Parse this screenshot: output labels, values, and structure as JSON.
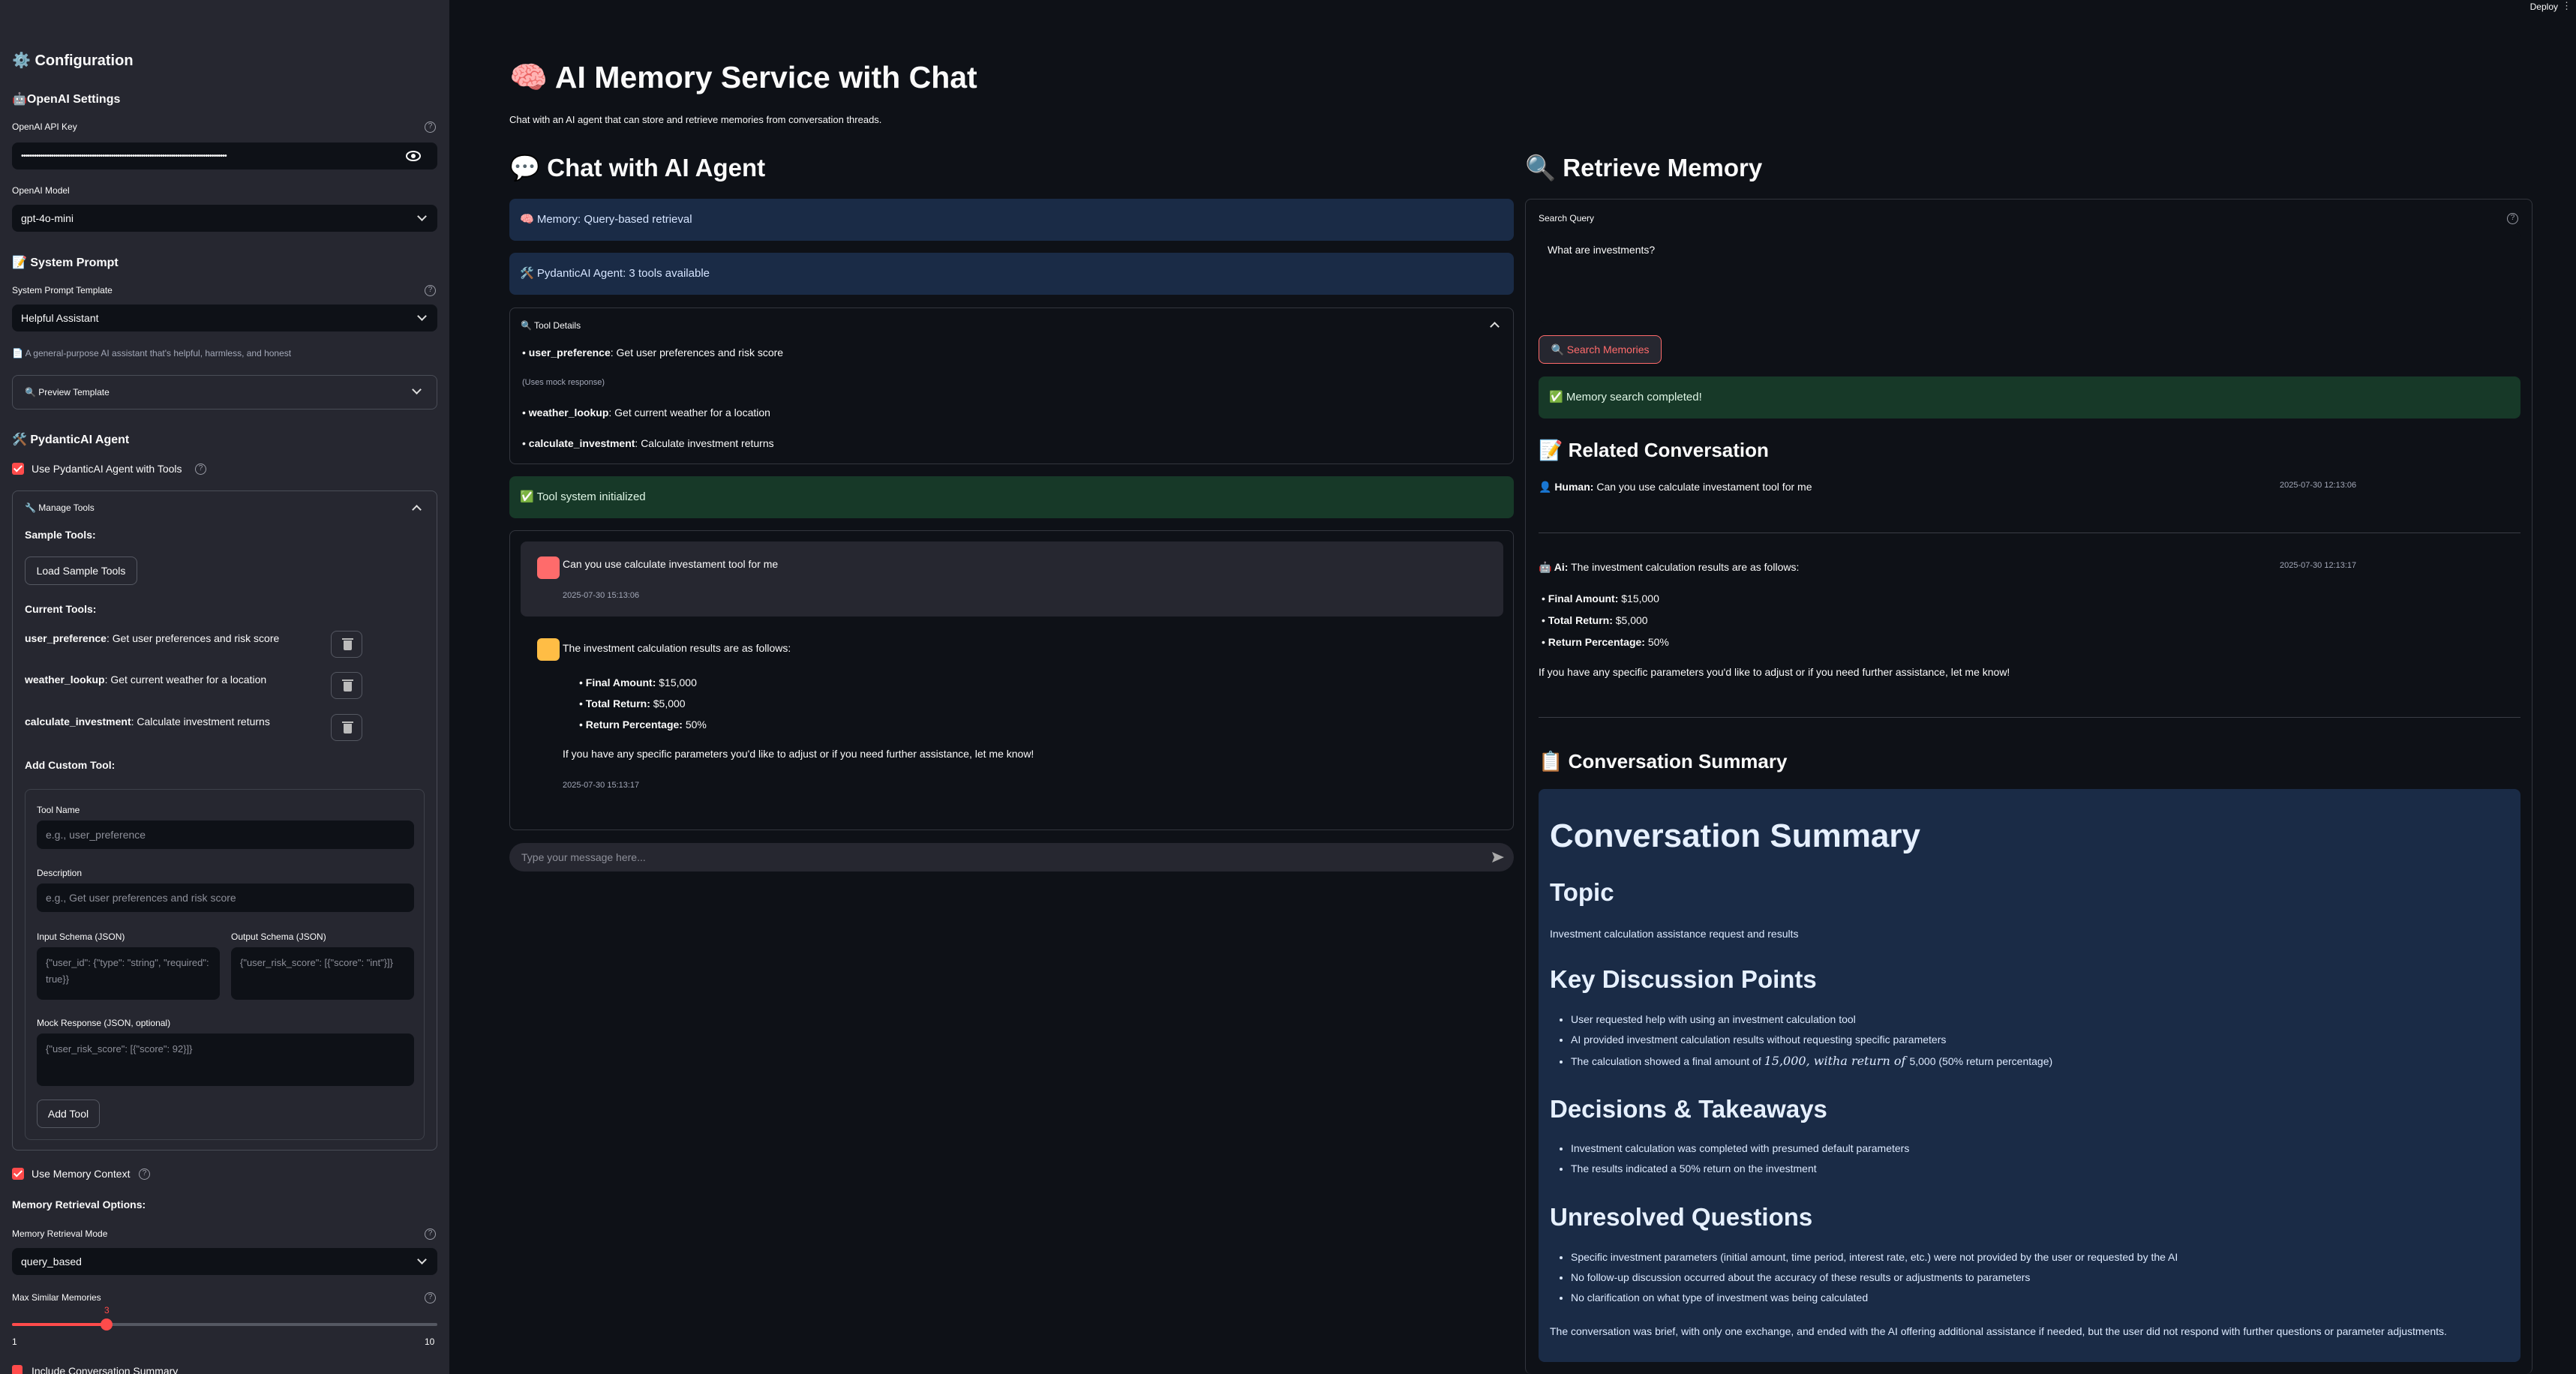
{
  "topbar": {
    "deploy": "Deploy"
  },
  "sidebar": {
    "config_title": "⚙️ Configuration",
    "openai_title": "OpenAI Settings",
    "api_key_label": "OpenAI API Key",
    "api_key_value": "••••••••••••••••••••••••••••••••••••••••••••••••••••••••••••••••••••••••••••••••••••••••••••••••",
    "model_label": "OpenAI Model",
    "model_value": "gpt-4o-mini",
    "system_prompt_title": "📝 System Prompt",
    "template_label": "System Prompt Template",
    "template_value": "Helpful Assistant",
    "template_desc": "📄 A general-purpose AI assistant that's helpful, harmless, and honest",
    "preview_label": "🔍 Preview Template",
    "agent_title": "🛠️ PydanticAI Agent",
    "use_agent_label": "Use PydanticAI Agent with Tools",
    "manage_tools_label": "🔧 Manage Tools",
    "sample_tools_label": "Sample Tools:",
    "load_sample_button": "Load Sample Tools",
    "current_tools_label": "Current Tools:",
    "tools": [
      {
        "name": "user_preference",
        "desc": ": Get user preferences and risk score"
      },
      {
        "name": "weather_lookup",
        "desc": ": Get current weather for a location"
      },
      {
        "name": "calculate_investment",
        "desc": ": Calculate investment returns"
      }
    ],
    "add_custom_label": "Add Custom Tool:",
    "tool_name_label": "Tool Name",
    "tool_name_placeholder": "e.g., user_preference",
    "description_label": "Description",
    "description_placeholder": "e.g., Get user preferences and risk score",
    "input_schema_label": "Input Schema (JSON)",
    "input_schema_placeholder": "{\"user_id\": {\"type\": \"string\", \"required\": true}}",
    "output_schema_label": "Output Schema (JSON)",
    "output_schema_placeholder": "{\"user_risk_score\": [{\"score\": \"int\"}]}",
    "mock_label": "Mock Response (JSON, optional)",
    "mock_placeholder": "{\"user_risk_score\": [{\"score\": 92}]}",
    "add_tool_button": "Add Tool",
    "use_memory_label": "Use Memory Context",
    "memory_options_label": "Memory Retrieval Options:",
    "memory_mode_label": "Memory Retrieval Mode",
    "memory_mode_value": "query_based",
    "max_similar_label": "Max Similar Memories",
    "slider_value": "3",
    "slider_min": "1",
    "slider_max": "10",
    "slider_fraction": 0.222,
    "include_summary_label": "Include Conversation Summary"
  },
  "header": {
    "title": "🧠 AI Memory Service with Chat",
    "subtitle": "Chat with an AI agent that can store and retrieve memories from conversation threads."
  },
  "chat": {
    "title": "💬 Chat with AI Agent",
    "info_memory": "🧠 Memory: Query-based retrieval",
    "info_agent": "🛠️ PydanticAI Agent: 3 tools available",
    "tool_details_label": "🔍 Tool Details",
    "tool_details": [
      {
        "name": "user_preference",
        "desc": ": Get user preferences and risk score"
      },
      {
        "name": "weather_lookup",
        "desc": ": Get current weather for a location"
      },
      {
        "name": "calculate_investment",
        "desc": ": Calculate investment returns"
      }
    ],
    "mock_note": "(Uses mock response)",
    "tool_status": "✅ Tool system initialized",
    "user_message": "Can you use calculate investament tool for me",
    "user_time": "2025-07-30 15:13:06",
    "ai_intro": "The investment calculation results are as follows:",
    "ai_items": [
      {
        "k": "Final Amount:",
        "v": " $15,000"
      },
      {
        "k": "Total Return:",
        "v": " $5,000"
      },
      {
        "k": "Return Percentage:",
        "v": " 50%"
      }
    ],
    "ai_outro": "If you have any specific parameters you'd like to adjust or if you need further assistance, let me know!",
    "ai_time": "2025-07-30 15:13:17",
    "input_placeholder": "Type your message here..."
  },
  "retrieve": {
    "title": "🔍 Retrieve Memory",
    "search_label": "Search Query",
    "search_value": "What are investments?",
    "search_button": "🔍 Search Memories",
    "search_status": "✅ Memory search completed!",
    "related_title": "📝 Related Conversation",
    "human_prefix": "👤 Human:",
    "human_text": " Can you use calculate investament tool for me",
    "human_time": "2025-07-30 12:13:06",
    "ai_prefix": "🤖 Ai:",
    "ai_text": " The investment calculation results are as follows:",
    "ai_time": "2025-07-30 12:13:17",
    "ai_items": [
      {
        "k": "Final Amount:",
        "v": " $15,000"
      },
      {
        "k": "Total Return:",
        "v": " $5,000"
      },
      {
        "k": "Return Percentage:",
        "v": " 50%"
      }
    ],
    "ai_outro": "If you have any specific parameters you'd like to adjust or if you need further assistance, let me know!",
    "summary_section_title": "📋 Conversation Summary",
    "summary": {
      "title": "Conversation Summary",
      "topic_heading": "Topic",
      "topic_text": "Investment calculation assistance request and results",
      "points_heading": "Key Discussion Points",
      "points": [
        "User requested help with using an investment calculation tool",
        "AI provided investment calculation results without requesting specific parameters"
      ],
      "point3_pre": "The calculation showed a final amount of ",
      "point3_math": "15,000, witha return of ",
      "point3_post": "5,000 (50% return percentage)",
      "decisions_heading": "Decisions & Takeaways",
      "decisions": [
        "Investment calculation was completed with presumed default parameters",
        "The results indicated a 50% return on the investment"
      ],
      "unresolved_heading": "Unresolved Questions",
      "unresolved": [
        "Specific investment parameters (initial amount, time period, interest rate, etc.) were not provided by the user or requested by the AI",
        "No follow-up discussion occurred about the accuracy of these results or adjustments to parameters",
        "No clarification on what type of investment was being calculated"
      ],
      "closing": "The conversation was brief, with only one exchange, and ended with the AI offering additional assistance if needed, but the user did not respond with further questions or parameter adjustments."
    }
  }
}
